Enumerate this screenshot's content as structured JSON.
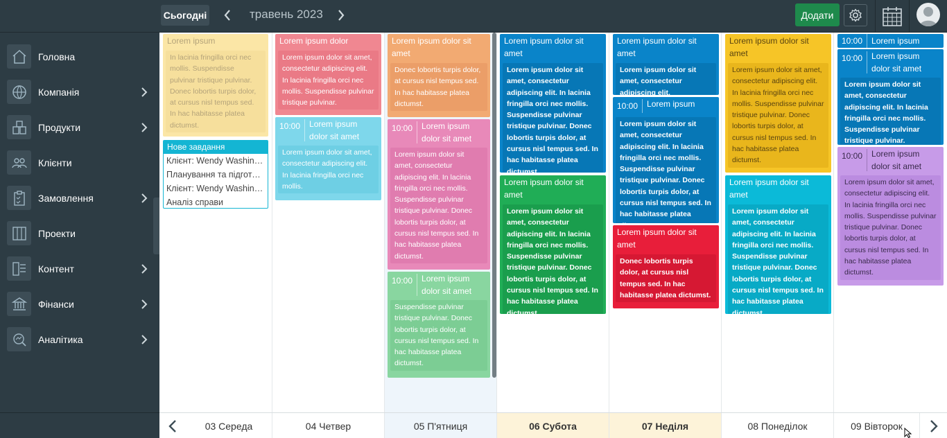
{
  "header": {
    "today_label": "Сьогодні",
    "period": "травень 2023",
    "add_label": "Додати"
  },
  "sidebar": {
    "items": [
      {
        "label": "Головна",
        "icon": "home-icon",
        "has_submenu": false
      },
      {
        "label": "Компанія",
        "icon": "globe-icon",
        "has_submenu": true
      },
      {
        "label": "Продукти",
        "icon": "boxes-icon",
        "has_submenu": true
      },
      {
        "label": "Клієнти",
        "icon": "people-icon",
        "has_submenu": false
      },
      {
        "label": "Замовлення",
        "icon": "clipboard-icon",
        "has_submenu": true
      },
      {
        "label": "Проекти",
        "icon": "columns-icon",
        "has_submenu": false
      },
      {
        "label": "Контент",
        "icon": "content-icon",
        "has_submenu": true
      },
      {
        "label": "Фінанси",
        "icon": "bank-icon",
        "has_submenu": true
      },
      {
        "label": "Аналітика",
        "icon": "analytics-icon",
        "has_submenu": true
      }
    ]
  },
  "calendar": {
    "days": [
      {
        "label": "03 Середа",
        "type": "normal"
      },
      {
        "label": "04 Четвер",
        "type": "normal"
      },
      {
        "label": "05 П'ятниця",
        "type": "today"
      },
      {
        "label": "06 Субота",
        "type": "weekend"
      },
      {
        "label": "07 Неділя",
        "type": "weekend"
      },
      {
        "label": "08 Понеділок",
        "type": "normal"
      },
      {
        "label": "09 Вівторок",
        "type": "normal"
      }
    ],
    "task_panel": {
      "title": "Нове завдання",
      "lines": [
        "Клієнт: Wendy Washington",
        "Планування та підготовка",
        "Клієнт: Wendy Washington",
        "Аналіз справи"
      ]
    },
    "events": {
      "e1": {
        "title": "Lorem ipsum",
        "body": "In lacinia fringilla orci nec mollis. Suspendisse pulvinar tristique pulvinar. Donec lobortis turpis dolor, at cursus nisl tempus sed. In hac habitasse platea dictumst."
      },
      "e2": {
        "title": "Lorem ipsum dolor",
        "body": "Lorem ipsum dolor sit amet, consectetur adipiscing elit. In lacinia fringilla orci nec mollis. Suspendisse pulvinar tristique pulvinar."
      },
      "e3": {
        "time": "10:00",
        "title": "Lorem ipsum dolor sit amet",
        "body": "Lorem ipsum dolor sit amet, consectetur adipiscing elit. In lacinia fringilla orci nec mollis."
      },
      "e4": {
        "title": "Lorem ipsum dolor sit amet",
        "body": "Donec lobortis turpis dolor, at cursus nisl tempus sed. In hac habitasse platea dictumst."
      },
      "e5": {
        "time": "10:00",
        "title": "Lorem ipsum dolor sit amet",
        "body": "Lorem ipsum dolor sit amet, consectetur adipiscing elit. In lacinia fringilla orci nec mollis. Suspendisse pulvinar tristique pulvinar. Donec lobortis turpis dolor, at cursus nisl tempus sed. In hac habitasse platea dictumst."
      },
      "e6": {
        "time": "10:00",
        "title": "Lorem ipsum dolor sit amet",
        "body": "Suspendisse pulvinar tristique pulvinar. Donec lobortis turpis dolor, at cursus nisl tempus sed. In hac habitasse platea dictumst."
      },
      "e7": {
        "title": "Lorem ipsum dolor sit amet",
        "body": "Lorem ipsum dolor sit amet, consectetur adipiscing elit. In lacinia fringilla orci nec mollis. Suspendisse pulvinar tristique pulvinar. Donec lobortis turpis dolor, at cursus nisl tempus sed. In hac habitasse platea dictumst."
      },
      "e8": {
        "title": "Lorem ipsum dolor sit amet",
        "body": "Lorem ipsum dolor sit amet, consectetur adipiscing elit. In lacinia fringilla orci nec mollis. Suspendisse pulvinar tristique pulvinar. Donec lobortis turpis dolor, at cursus nisl tempus sed. In hac habitasse platea dictumst."
      },
      "e9": {
        "title": "Lorem ipsum dolor sit amet",
        "body": "Lorem ipsum dolor sit amet, consectetur adipiscing elit."
      },
      "e10": {
        "time": "10:00",
        "title": "Lorem ipsum",
        "body": "Lorem ipsum dolor sit amet, consectetur adipiscing elit. In lacinia fringilla orci nec mollis. Suspendisse pulvinar tristique pulvinar. Donec lobortis turpis dolor, at cursus nisl tempus sed. In hac habitasse platea dictumst."
      },
      "e11": {
        "title": "Lorem ipsum dolor sit amet",
        "body": "Donec lobortis turpis dolor, at cursus nisl tempus sed. In hac habitasse platea dictumst."
      },
      "e12": {
        "title": "Lorem ipsum dolor sit amet",
        "body": "Lorem ipsum dolor sit amet, consectetur adipiscing elit. In lacinia fringilla orci nec mollis. Suspendisse pulvinar tristique pulvinar. Donec lobortis turpis dolor, at cursus nisl tempus sed. In hac habitasse platea dictumst."
      },
      "e13": {
        "title": "Lorem ipsum dolor sit amet",
        "body": "Lorem ipsum dolor sit amet, consectetur adipiscing elit. In lacinia fringilla orci nec mollis. Suspendisse pulvinar tristique pulvinar. Donec lobortis turpis dolor, at cursus nisl tempus sed. In hac habitasse platea dictumst."
      },
      "e14": {
        "time": "10:00",
        "title": "Lorem ipsum dolor"
      },
      "e15": {
        "time": "10:00",
        "title": "Lorem ipsum dolor sit amet",
        "body": "Lorem ipsum dolor sit amet, consectetur adipiscing elit. In lacinia fringilla orci nec mollis. Suspendisse pulvinar tristique pulvinar."
      },
      "e16": {
        "time": "10:00",
        "title": "Lorem ipsum dolor sit amet",
        "body": "Lorem ipsum dolor sit amet, consectetur adipiscing elit. In lacinia fringilla orci nec mollis. Suspendisse pulvinar tristique pulvinar. Donec lobortis turpis dolor, at cursus nisl tempus sed. In hac habitasse platea dictumst."
      }
    }
  },
  "colors": {
    "topbar": "#2d3c44",
    "add_button": "#1e8a4c",
    "task_accent": "#14b5d3"
  }
}
